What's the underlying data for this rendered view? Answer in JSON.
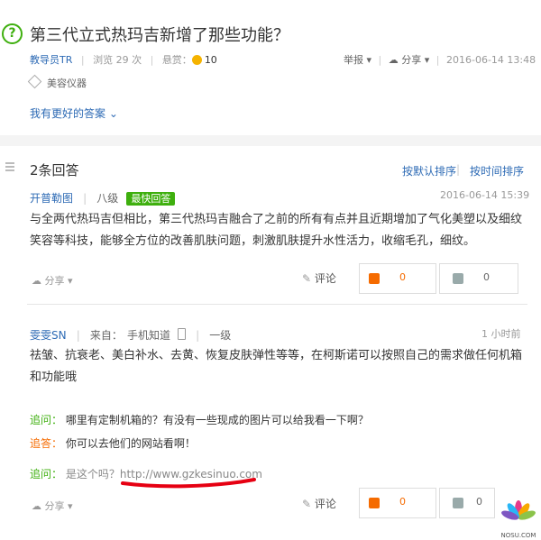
{
  "question": {
    "title": "第三代立式热玛吉新增了那些功能？",
    "author": "教导员TR",
    "views": "浏览 29 次",
    "bounty_label": "悬赏：",
    "bounty_value": "10",
    "report": "举报",
    "share": "分享",
    "date": "2016-06-14 13:48",
    "tag": "美容仪器",
    "better_answer": "我有更好的答案"
  },
  "answers_header": {
    "count": "2条回答",
    "sort_default": "按默认排序",
    "sort_time": "按时间排序"
  },
  "answer1": {
    "user": "开普勒图",
    "level": "八级",
    "badge": "最快回答",
    "date": "2016-06-14 15:39",
    "text": "与全两代热玛吉但相比，第三代热玛吉融合了之前的所有有点并且近期增加了气化美塑以及细纹笑容等科技，能够全方位的改善肌肤问题，刺激肌肤提升水性活力，收缩毛孔，细纹。",
    "share": "分享",
    "comment": "评论",
    "likes": "0",
    "dislikes": "0"
  },
  "answer2": {
    "user": "雯雯SN",
    "source_label": "来自：",
    "source": "手机知道",
    "level": "一级",
    "time": "1 小时前",
    "text": "祛皱、抗衰老、美白补水、去黄、恢复皮肤弹性等等，在柯斯诺可以按照自己的需求做任何机箱和功能哦",
    "followups": [
      {
        "label": "追问：",
        "text": "哪里有定制机箱的？有没有一些现成的图片可以给我看一下啊？"
      },
      {
        "label": "追答：",
        "text": "你可以去他们的网站看啊！"
      },
      {
        "label": "追问：",
        "text": "是这个吗？http://www.gzkesinuo.com"
      }
    ],
    "share": "分享",
    "comment": "评论",
    "likes": "0",
    "dislikes": "0"
  },
  "watermark": "NOSU.COM",
  "colors": {
    "accent_green": "#3eaf0e",
    "link_blue": "#2e6bb5",
    "answer_orange": "#f56b00",
    "like_orange": "#f56b00",
    "redline": "#e60012"
  }
}
